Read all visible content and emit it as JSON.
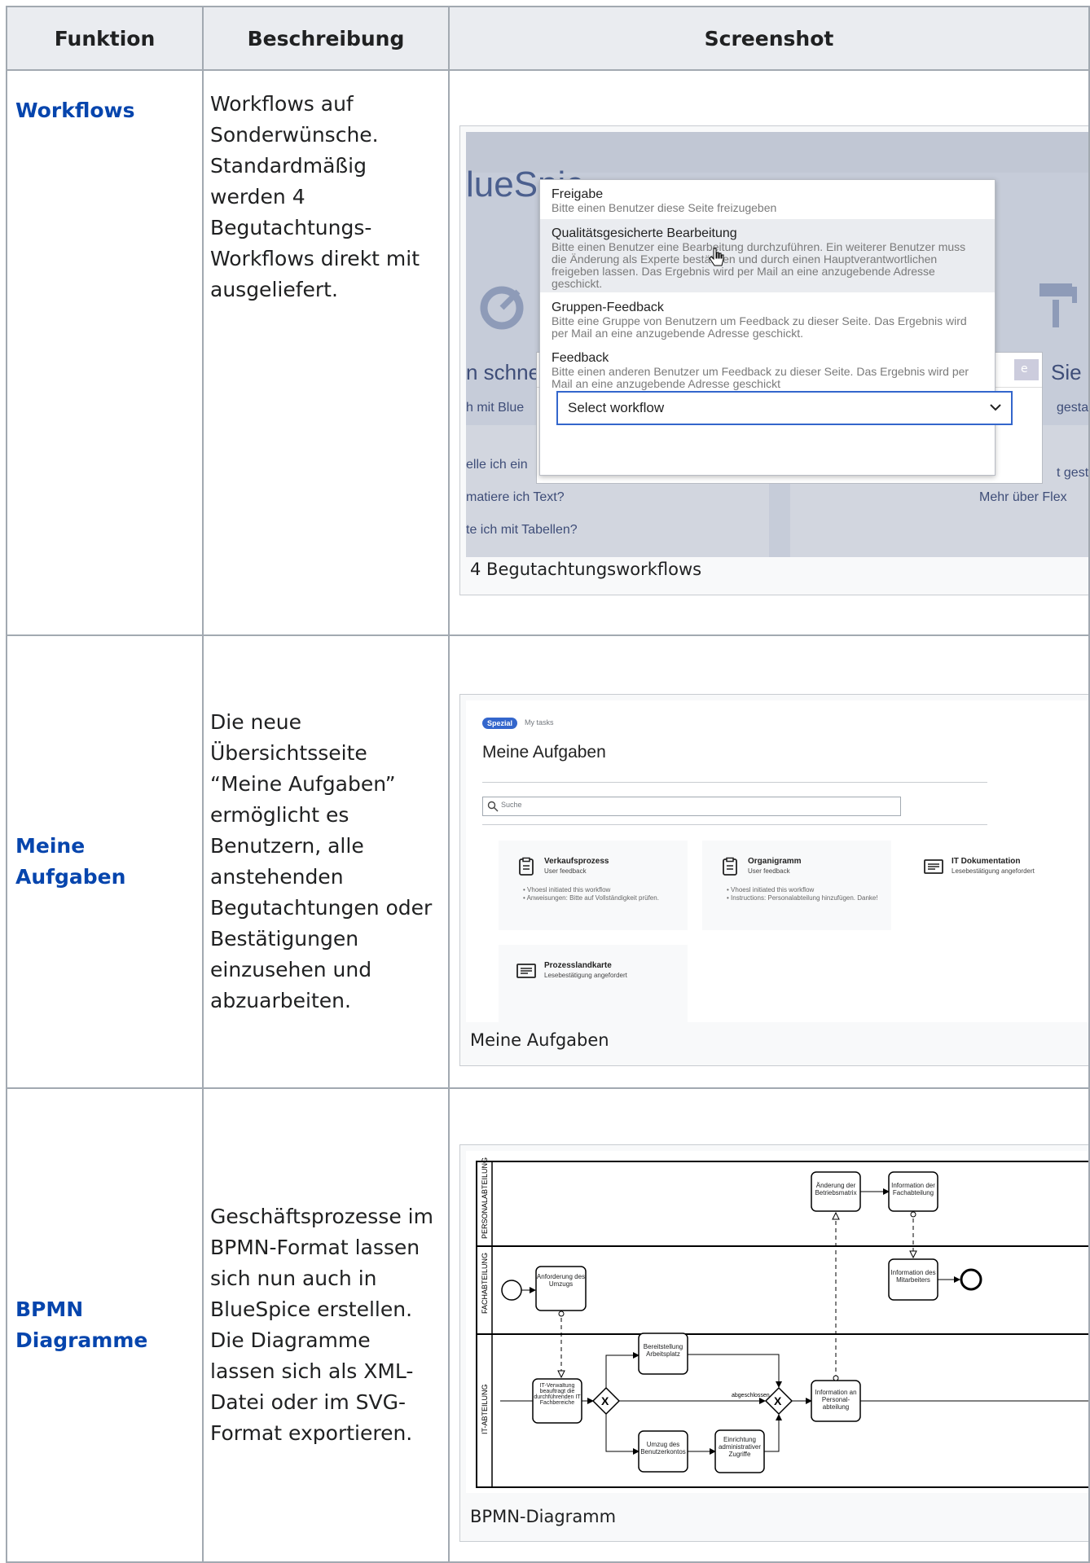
{
  "table": {
    "headers": [
      "Funktion",
      "Beschreibung",
      "Screenshot"
    ],
    "rows": [
      {
        "function": "Workflows",
        "description": "Workflows auf Sonderwünsche. Standardmäßig werden 4 Begutachtungs-Workflows direkt mit ausgeliefert.",
        "caption": "4 Begutachtungsworkflows"
      },
      {
        "function": "Meine Aufgaben",
        "description": "Die neue Übersichtsseite “Meine Aufgaben” ermöglicht es Benutzern, alle anstehenden Begutachtungen oder Bestätigungen einzusehen und abzuarbeiten.",
        "caption": "Meine Aufgaben"
      },
      {
        "function": "BPMN Diagramme",
        "description": "Geschäftsprozesse im BPMN-Format lassen sich nun auch in BlueSpice erstellen. Die Diagramme lassen sich als XML-Datei oder im SVG-Format exportieren.",
        "caption": "BPMN-Diagramm"
      }
    ]
  },
  "workflows_shot": {
    "logo": "lueSpic",
    "bg_texts": [
      "n schne",
      "h mit Blue",
      "elle ich ein",
      "matiere ich Text?",
      "te ich mit Tabellen?",
      "Sie Ih",
      "gestalt",
      "t gesta",
      "Mehr über Flex",
      "c",
      "e"
    ],
    "options": [
      {
        "title": "Freigabe",
        "desc": "Bitte einen Benutzer diese Seite freizugeben"
      },
      {
        "title": "Qualitätsgesicherte Bearbeitung",
        "desc": "Bitte einen Benutzer eine Bearbeitung durchzuführen. Ein weiterer Benutzer muss die Änderung als Experte bestätigen und durch einen Hauptverantwortlichen freigeben lassen. Das Ergebnis wird per Mail an eine anzugebende Adresse geschickt."
      },
      {
        "title": "Gruppen-Feedback",
        "desc": "Bitte eine Gruppe von Benutzern um Feedback zu dieser Seite. Das Ergebnis wird per Mail an eine anzugebende Adresse geschickt."
      },
      {
        "title": "Feedback",
        "desc": "Bitte einen anderen Benutzer um Feedback zu dieser Seite. Das Ergebnis wird per Mail an eine anzugebende Adresse geschickt"
      }
    ],
    "select_label": "Select workflow"
  },
  "tasks_shot": {
    "badge": "Spezial",
    "breadcrumb": "My tasks",
    "heading": "Meine Aufgaben",
    "search_placeholder": "Suche",
    "tasks": [
      {
        "title": "Verkaufsprozess",
        "subtitle": "User feedback",
        "icon": "clipboard-icon",
        "lines": [
          "Vhoesl initiated this workflow",
          "Anweisungen: Bitte auf Vollständigkeit prüfen."
        ]
      },
      {
        "title": "Organigramm",
        "subtitle": "User feedback",
        "icon": "clipboard-icon",
        "lines": [
          "Vhoesl initiated this workflow",
          "Instructions: Personalabteilung hinzufügen. Danke!"
        ]
      },
      {
        "title": "IT Dokumentation",
        "subtitle": "Lesebestätigung angefordert",
        "icon": "document-icon",
        "lines": []
      },
      {
        "title": "Prozesslandkarte",
        "subtitle": "Lesebestätigung angefordert",
        "icon": "document-icon",
        "lines": []
      }
    ]
  },
  "bpmn_shot": {
    "lanes": [
      "PERSONALABTEILUNG",
      "FACHABTEILUNG",
      "IT-ABTEILUNG"
    ],
    "tasks": {
      "aenderung": "Änderung der Betriebsmatrix",
      "info_fach": "Information der Fachabteilung",
      "info_mit": "Information des Mitarbeiters",
      "anforderung": "Anforderung des Umzugs",
      "it_verwaltung": "IT-Verwaltung beauftragt die durchführenden IT Fachbereiche",
      "bereitstellung": "Bereitstellung Arbeitsplatz",
      "umzug": "Umzug des Benutzerkontos",
      "einrichtung": "Einrichtung administrativer Zugriffe",
      "info_personal": "Information an Personal-abteilung"
    },
    "flow_label": "abgeschlossen"
  }
}
